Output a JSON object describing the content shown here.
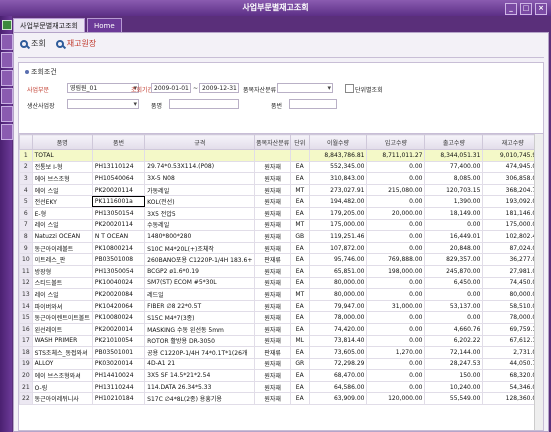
{
  "window": {
    "title": "사업부문별재고조회"
  },
  "tabs": [
    {
      "label": "사업부문별재고조회"
    },
    {
      "label": "Home"
    }
  ],
  "toolbar": {
    "search_label": "조회",
    "report_label": "재고원장"
  },
  "conditions": {
    "title": "조회조건",
    "division_label": "사업부문",
    "division_value": "영림원_01",
    "period_label": "조회기간",
    "period_from": "2009-01-01",
    "period_to": "2009-12-31",
    "asset_label": "품목자산분류",
    "unit_check_label": "단위별조회",
    "warehouse_label": "생산사업장",
    "item_label": "품명",
    "spec_label": "품번"
  },
  "grid": {
    "headers": [
      "품명",
      "품번",
      "규격",
      "품목자산분류",
      "단위",
      "이월수량",
      "입고수량",
      "출고수량",
      "재고수량"
    ],
    "rows": [
      [
        "TOTAL",
        "",
        "",
        "",
        "",
        "8,843,786.81",
        "8,711,011.27",
        "8,344,051.31",
        "9,010,745.97"
      ],
      [
        "전통보 I-형",
        "PH13110124",
        "29.74*0.53X114.(P08)",
        "원자재",
        "EA",
        "552,345.00",
        "0.00",
        "77,400.00",
        "474,945.00"
      ],
      [
        "에어 브스조형",
        "PH10540064",
        "3X-5 N08",
        "원자재",
        "EA",
        "310,843.00",
        "0.00",
        "8,085.00",
        "306,858.00"
      ],
      [
        "에이 스일",
        "PK20020114",
        "가동레일",
        "원자재",
        "MT",
        "273,027.91",
        "215,080.00",
        "120,703.15",
        "368,204.76"
      ],
      [
        "전선EKY",
        "PK1116001a",
        "KOL(전선)",
        "원자재",
        "EA",
        "194,482.00",
        "0.00",
        "1,390.00",
        "193,092.00"
      ],
      [
        "E-형",
        "PH13050154",
        "3X5 전압5",
        "원자재",
        "EA",
        "179,205.00",
        "20,000.00",
        "18,149.00",
        "181,146.00"
      ],
      [
        "레이 스일",
        "PK20020114",
        "수동레일",
        "원자재",
        "MT",
        "175,000.00",
        "0.00",
        "0.00",
        "175,000.00"
      ],
      [
        "Natuzzi OCEAN",
        "N T OCEAN",
        "1480*800*280",
        "원자재",
        "GB",
        "119,251.46",
        "0.00",
        "16,449.01",
        "102,802.45"
      ],
      [
        "동근아이레볼트",
        "PK10800214",
        "S10C M4*20L(+)조체작",
        "원자재",
        "EA",
        "107,872.00",
        "0.00",
        "20,848.00",
        "87,024.00"
      ],
      [
        "이트레스_판",
        "PB03501008",
        "260BANO포용 C1220P-1/4H 183.6+",
        "판재류",
        "EA",
        "95,746.00",
        "769,888.00",
        "829,357.00",
        "36,277.00"
      ],
      [
        "방장형",
        "PH13050054",
        "BCGP2 ø1.6*0.19",
        "원자재",
        "EA",
        "65,851.00",
        "198,000.00",
        "245,870.00",
        "27,981.00"
      ],
      [
        "스티드볼트",
        "PK10040024",
        "SM7(ST) ECOM #5*30L",
        "원자재",
        "EA",
        "80,000.00",
        "0.00",
        "6,450.00",
        "74,450.00"
      ],
      [
        "레이 스일",
        "PK20020084",
        "레드일",
        "원자재",
        "MT",
        "80,000.00",
        "0.00",
        "0.00",
        "80,000.00"
      ],
      [
        "파이버와셔",
        "PK10420064",
        "FIBER ∅8 22*0.5T",
        "원자재",
        "EA",
        "79,947.00",
        "31,000.00",
        "53,137.00",
        "58,510.00"
      ],
      [
        "동근아이렌트이트볼트",
        "PK10080024",
        "S15C M4*7(3종)",
        "원자재",
        "EA",
        "78,000.00",
        "0.00",
        "0.00",
        "78,000.00"
      ],
      [
        "왼선레이트",
        "PK20020014",
        "MASKING 수동 왼선동 5mm",
        "원자재",
        "EA",
        "74,420.00",
        "0.00",
        "4,660.76",
        "69,759.14"
      ],
      [
        "WASH PRIMER",
        "PK21010054",
        "ROTOR 활방용 DR-3050",
        "원자재",
        "ML",
        "73,814.40",
        "0.00",
        "6,202.22",
        "67,612.18"
      ],
      [
        "STS조체스_동접와셔",
        "PB03501001",
        "공용 C1220P-1/4H 74*0.1T*1(26개",
        "판재류",
        "EA",
        "73,605.00",
        "1,270.00",
        "72,144.00",
        "2,731.00"
      ],
      [
        "ALLOY",
        "PK03020014",
        "4D-A1 21",
        "원자재",
        "GR",
        "72,298.29",
        "0.00",
        "28,247.53",
        "44,050.76"
      ],
      [
        "에이 브스조형와셔",
        "PH14410024",
        "3X5 SF 14.5*21*2.54",
        "원자재",
        "EA",
        "68,470.00",
        "0.00",
        "150.00",
        "68,320.00"
      ],
      [
        "O-링",
        "PH13110244",
        "114.DATA 26.34*5.33",
        "원자재",
        "EA",
        "64,586.00",
        "0.00",
        "10,240.00",
        "54,346.00"
      ],
      [
        "동근아이레뒤니사",
        "PH10210184",
        "S17C ∅4*8L(2종) 용흥기용",
        "원자재",
        "EA",
        "63,909.00",
        "120,000.00",
        "55,549.00",
        "128,360.00"
      ]
    ]
  }
}
